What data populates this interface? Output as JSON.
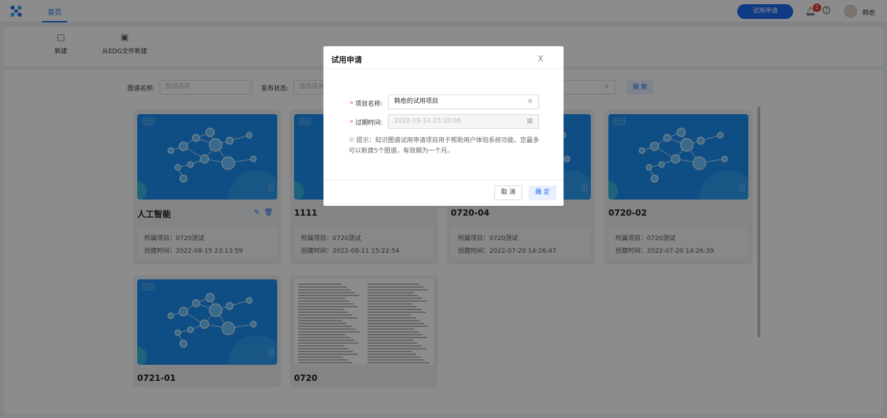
{
  "topbar": {
    "nav_home": "首页",
    "trial_button": "试用申请",
    "notification_count": "1",
    "help_symbol": "?",
    "username": "韩愈"
  },
  "toolbar": {
    "new_label": "新建",
    "new_from_edg_label": "从EDG文件新建"
  },
  "filters": {
    "name_label": "图谱名称:",
    "name_placeholder": "图谱名称",
    "status_label": "发布状态:",
    "status_placeholder": "请选择发",
    "search_button": "搜 索"
  },
  "cards": [
    {
      "title": "人工智能",
      "project": "所属项目：0720测试",
      "created": "创建时间：2022-08-15 23:13:59",
      "thumb": "network"
    },
    {
      "title": "1111",
      "project": "所属项目：0720测试",
      "created": "创建时间：2022-08-11 15:22:54",
      "thumb": "network"
    },
    {
      "title": "0720-04",
      "project": "所属项目：0720测试",
      "created": "创建时间：2022-07-20 14:26:47",
      "thumb": "network"
    },
    {
      "title": "0720-02",
      "project": "所属项目：0720测试",
      "created": "创建时间：2022-07-20 14:26:39",
      "thumb": "network"
    },
    {
      "title": "0721-01",
      "thumb": "network"
    },
    {
      "title": "0720",
      "thumb": "document"
    }
  ],
  "modal": {
    "title": "试用申请",
    "close": "X",
    "project_name_label": "项目名称:",
    "project_name_value": "韩愈的试用项目",
    "expire_label": "过期时间:",
    "expire_value": "2022-09-14 23:18:06",
    "tip": "提示：知识图谱试用申请项目用于帮助用户体验系统功能，您最多可以新建5个图谱，有效期为一个月。",
    "cancel": "取 消",
    "confirm": "确 定"
  },
  "colors": {
    "primary": "#1d6cf2",
    "required": "#e53935"
  }
}
